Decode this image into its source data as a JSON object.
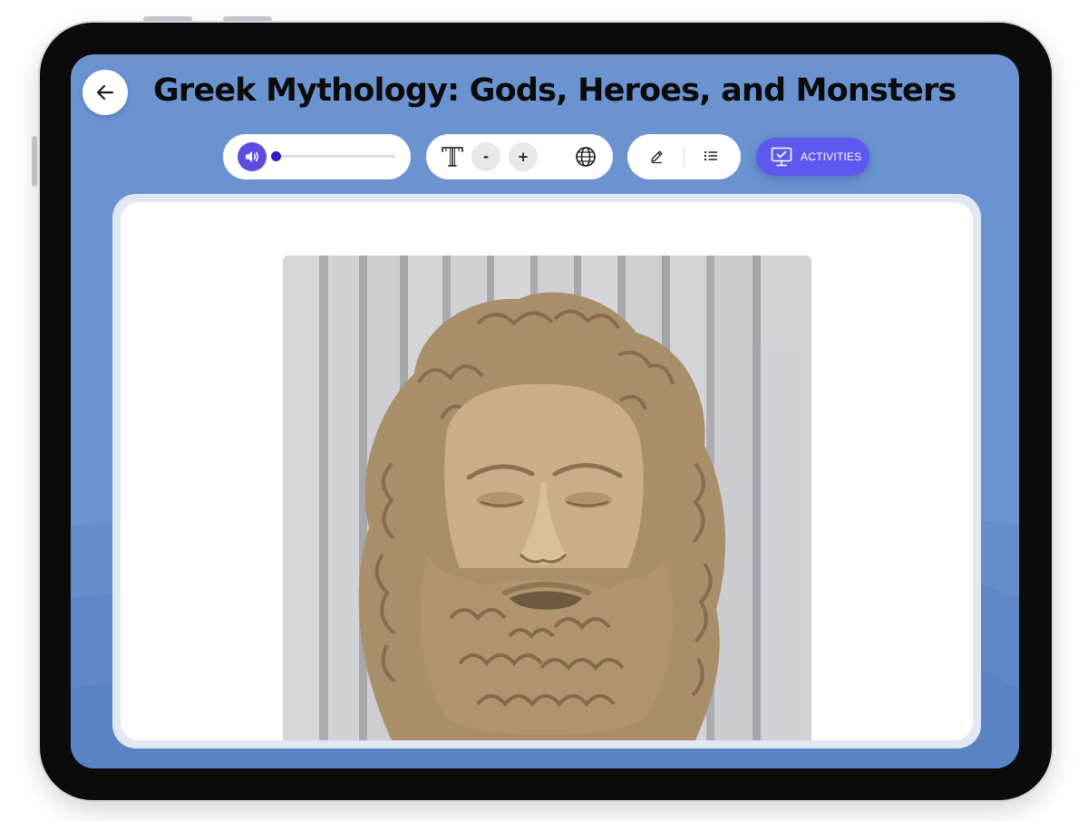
{
  "page": {
    "title": "Greek Mythology: Gods, Heroes, and Monsters"
  },
  "toolbar": {
    "audio": {
      "progress": 0.0
    },
    "text_size": {
      "decrease_label": "-",
      "increase_label": "+"
    },
    "activities_label": "ACTIVITIES"
  },
  "icons": {
    "back": "arrow-left-icon",
    "audio": "speaker-icon",
    "text_size": "text-size-icon",
    "language": "globe-icon",
    "annotate": "pencil-icon",
    "outline": "list-icon",
    "activities": "monitor-check-icon"
  },
  "content": {
    "image": {
      "subject": "marble-bust-photo"
    }
  },
  "colors": {
    "background": "#6a93cf",
    "accent": "#5d58ee",
    "audio_button": "#5e4be0",
    "progress_knob": "#2f1fc4",
    "title": "#0a0a0a"
  }
}
